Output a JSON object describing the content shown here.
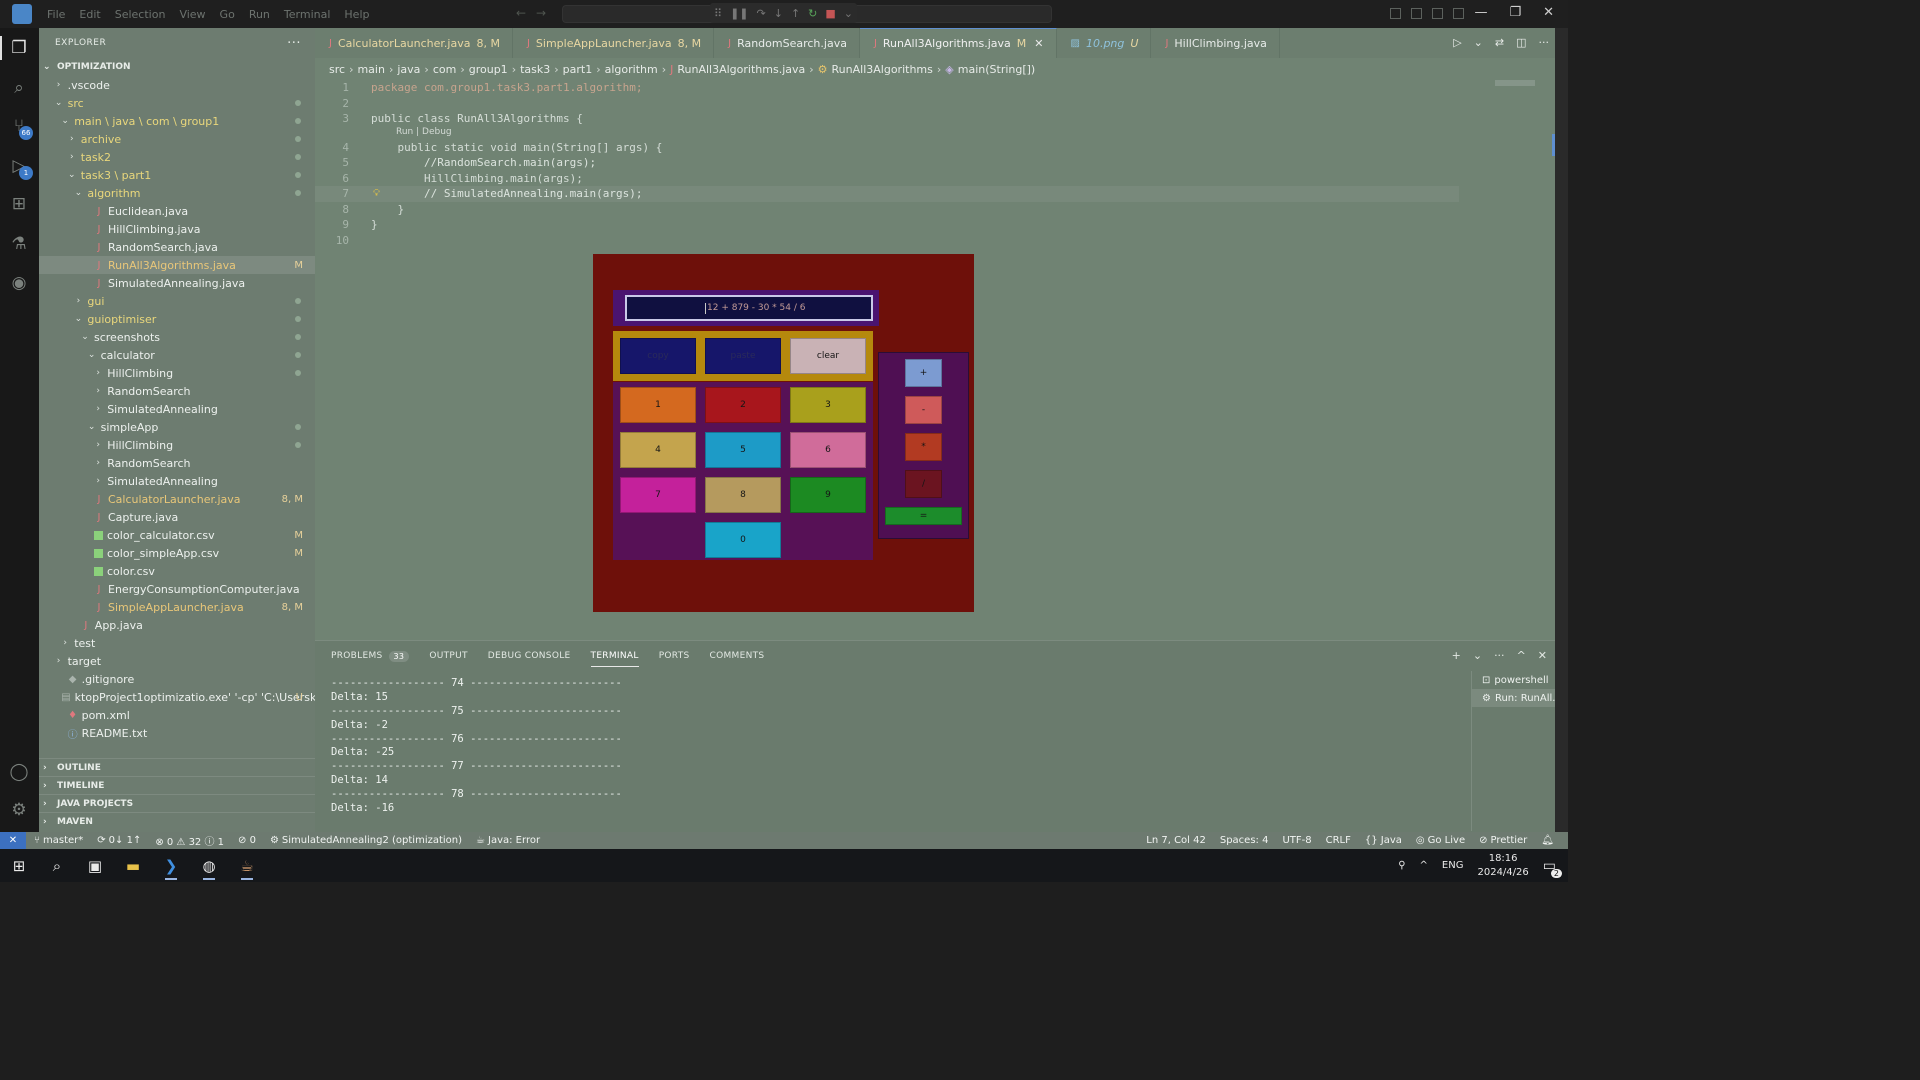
{
  "titlebar": {
    "menus": [
      "File",
      "Edit",
      "Selection",
      "View",
      "Go",
      "Run",
      "Terminal",
      "Help"
    ],
    "window_controls": [
      "—",
      "❐",
      "✕"
    ]
  },
  "activity_bar": {
    "scm_badge": "66",
    "debug_badge": "1"
  },
  "sidebar": {
    "title": "EXPLORER",
    "more": "···",
    "root": "OPTIMIZATION",
    "tree": [
      {
        "label": ".vscode",
        "depth": 1,
        "kind": "folder-closed",
        "plain": true
      },
      {
        "label": "src",
        "depth": 1,
        "kind": "folder-open",
        "dot": true
      },
      {
        "label": "main \\ java \\ com \\ group1",
        "depth": 2,
        "kind": "folder-open",
        "dot": true
      },
      {
        "label": "archive",
        "depth": 3,
        "kind": "folder-closed",
        "dot": true
      },
      {
        "label": "task2",
        "depth": 3,
        "kind": "folder-closed",
        "dot": true
      },
      {
        "label": "task3 \\ part1",
        "depth": 3,
        "kind": "folder-open",
        "dot": true
      },
      {
        "label": "algorithm",
        "depth": 4,
        "kind": "folder-open",
        "dot": true
      },
      {
        "label": "Euclidean.java",
        "depth": 5,
        "kind": "java"
      },
      {
        "label": "HillClimbing.java",
        "depth": 5,
        "kind": "java"
      },
      {
        "label": "RandomSearch.java",
        "depth": 5,
        "kind": "java"
      },
      {
        "label": "RunAll3Algorithms.java",
        "depth": 5,
        "kind": "java",
        "decor": "M",
        "modified": true,
        "selected": true
      },
      {
        "label": "SimulatedAnnealing.java",
        "depth": 5,
        "kind": "java"
      },
      {
        "label": "gui",
        "depth": 4,
        "kind": "folder-closed",
        "dot": true
      },
      {
        "label": "guioptimiser",
        "depth": 4,
        "kind": "folder-open",
        "dot": true
      },
      {
        "label": "screenshots",
        "depth": 5,
        "kind": "folder-open",
        "dot": true,
        "plain": true
      },
      {
        "label": "calculator",
        "depth": 6,
        "kind": "folder-open",
        "dot": true,
        "plain": true
      },
      {
        "label": "HillClimbing",
        "depth": 7,
        "kind": "folder-closed",
        "dot": true,
        "plain": true
      },
      {
        "label": "RandomSearch",
        "depth": 7,
        "kind": "folder-closed",
        "plain": true
      },
      {
        "label": "SimulatedAnnealing",
        "depth": 7,
        "kind": "folder-closed",
        "plain": true
      },
      {
        "label": "simpleApp",
        "depth": 6,
        "kind": "folder-open",
        "dot": true,
        "plain": true
      },
      {
        "label": "HillClimbing",
        "depth": 7,
        "kind": "folder-closed",
        "dot": true,
        "plain": true
      },
      {
        "label": "RandomSearch",
        "depth": 7,
        "kind": "folder-closed",
        "plain": true
      },
      {
        "label": "SimulatedAnnealing",
        "depth": 7,
        "kind": "folder-closed",
        "plain": true
      },
      {
        "label": "CalculatorLauncher.java",
        "depth": 5,
        "kind": "java",
        "decor": "8, M",
        "modified": true
      },
      {
        "label": "Capture.java",
        "depth": 5,
        "kind": "java"
      },
      {
        "label": "color_calculator.csv",
        "depth": 5,
        "kind": "csv",
        "decor": "M"
      },
      {
        "label": "color_simpleApp.csv",
        "depth": 5,
        "kind": "csv",
        "decor": "M"
      },
      {
        "label": "color.csv",
        "depth": 5,
        "kind": "csv"
      },
      {
        "label": "EnergyConsumptionComputer.java",
        "depth": 5,
        "kind": "java"
      },
      {
        "label": "SimpleAppLauncher.java",
        "depth": 5,
        "kind": "java",
        "decor": "8, M",
        "modified": true
      },
      {
        "label": "App.java",
        "depth": 3,
        "kind": "java"
      },
      {
        "label": "test",
        "depth": 2,
        "kind": "folder-closed",
        "plain": true
      },
      {
        "label": "target",
        "depth": 1,
        "kind": "folder-closed",
        "plain": true
      },
      {
        "label": ".gitignore",
        "depth": 1,
        "kind": "git"
      },
      {
        "label": "ktopProject1optimizatio.exe' '-cp' 'C:\\Usersku...",
        "depth": 1,
        "kind": "exe",
        "decor": "U"
      },
      {
        "label": "pom.xml",
        "depth": 1,
        "kind": "xml"
      },
      {
        "label": "README.txt",
        "depth": 1,
        "kind": "info"
      }
    ],
    "bottom_sections": [
      "OUTLINE",
      "TIMELINE",
      "JAVA PROJECTS",
      "MAVEN"
    ]
  },
  "editor": {
    "tabs": [
      {
        "label": "CalculatorLauncher.java",
        "mod": "8, M",
        "style": "modified"
      },
      {
        "label": "SimpleAppLauncher.java",
        "mod": "8, M",
        "style": "modified"
      },
      {
        "label": "RandomSearch.java",
        "mod": "",
        "style": "plain"
      },
      {
        "label": "RunAll3Algorithms.java",
        "mod": "M",
        "style": "active"
      },
      {
        "label": "10.png",
        "mod": "U",
        "style": "italic"
      },
      {
        "label": "HillClimbing.java",
        "mod": "",
        "style": "plain"
      }
    ],
    "breadcrumb": [
      "src",
      "main",
      "java",
      "com",
      "group1",
      "task3",
      "part1",
      "algorithm",
      "RunAll3Algorithms.java",
      "RunAll3Algorithms",
      "main(String[])"
    ],
    "codelens": "Run | Debug",
    "code_lines": [
      "package com.group1.task3.part1.algorithm;",
      "",
      "public class RunAll3Algorithms {",
      "    public static void main(String[] args) {",
      "        //RandomSearch.main(args);",
      "        HillClimbing.main(args);",
      "        // SimulatedAnnealing.main(args);",
      "    }",
      "}",
      ""
    ]
  },
  "calculator": {
    "display": "12 + 879 - 30 * 54 / 6",
    "controls": [
      {
        "label": "copy",
        "color": "#16166a"
      },
      {
        "label": "paste",
        "color": "#16166a"
      },
      {
        "label": "clear",
        "color": "#c9b2b5"
      }
    ],
    "digits": [
      {
        "label": "1",
        "color": "#d4691f"
      },
      {
        "label": "2",
        "color": "#a8161c"
      },
      {
        "label": "3",
        "color": "#a9a01c"
      },
      {
        "label": "4",
        "color": "#c4a44d"
      },
      {
        "label": "5",
        "color": "#1d9bc7"
      },
      {
        "label": "6",
        "color": "#d06c9a"
      },
      {
        "label": "7",
        "color": "#c4219b"
      },
      {
        "label": "8",
        "color": "#b59a5e"
      },
      {
        "label": "9",
        "color": "#1c8a22"
      },
      {
        "label": "0",
        "color": "#19a4c9"
      }
    ],
    "operators": [
      {
        "label": "+",
        "color": "#7c9bd1"
      },
      {
        "label": "-",
        "color": "#cf5a5a"
      },
      {
        "label": "*",
        "color": "#b23a22"
      },
      {
        "label": "/",
        "color": "#6b1420"
      },
      {
        "label": "=",
        "color": "#1c8c2b"
      }
    ]
  },
  "panel": {
    "tabs": [
      {
        "label": "PROBLEMS",
        "badge": "33"
      },
      {
        "label": "OUTPUT",
        "badge": ""
      },
      {
        "label": "DEBUG CONSOLE",
        "badge": ""
      },
      {
        "label": "TERMINAL",
        "badge": "",
        "active": true
      },
      {
        "label": "PORTS",
        "badge": ""
      },
      {
        "label": "COMMENTS",
        "badge": ""
      }
    ],
    "actions": [
      "+",
      "⌄",
      "···",
      "^",
      "✕"
    ],
    "terminal_lines": [
      "------------------ 74 ------------------------",
      "Delta: 15",
      "------------------ 75 ------------------------",
      "Delta: -2",
      "------------------ 76 ------------------------",
      "Delta: -25",
      "------------------ 77 ------------------------",
      "Delta: 14",
      "------------------ 78 ------------------------",
      "Delta: -16"
    ],
    "terminals": [
      {
        "label": "powershell",
        "icon": "⊡"
      },
      {
        "label": "Run: RunAll...",
        "icon": "⚙"
      }
    ]
  },
  "statusbar": {
    "remote": "✕",
    "branch": "master*",
    "sync": "0↓ 1↑",
    "errors": "⊗ 0 ⚠ 32 ⓘ 1",
    "ports": "⊘ 0",
    "launch": "SimulatedAnnealing2 (optimization)",
    "java_status": "Java: Error",
    "position": "Ln 7, Col 42",
    "spaces": "Spaces: 4",
    "encoding": "UTF-8",
    "eol": "CRLF",
    "language": "{} Java",
    "golive": "Go Live",
    "prettier": "Prettier"
  },
  "taskbar": {
    "lang": "ENG",
    "time": "18:16",
    "date": "2024/4/26",
    "notif_count": "2"
  }
}
